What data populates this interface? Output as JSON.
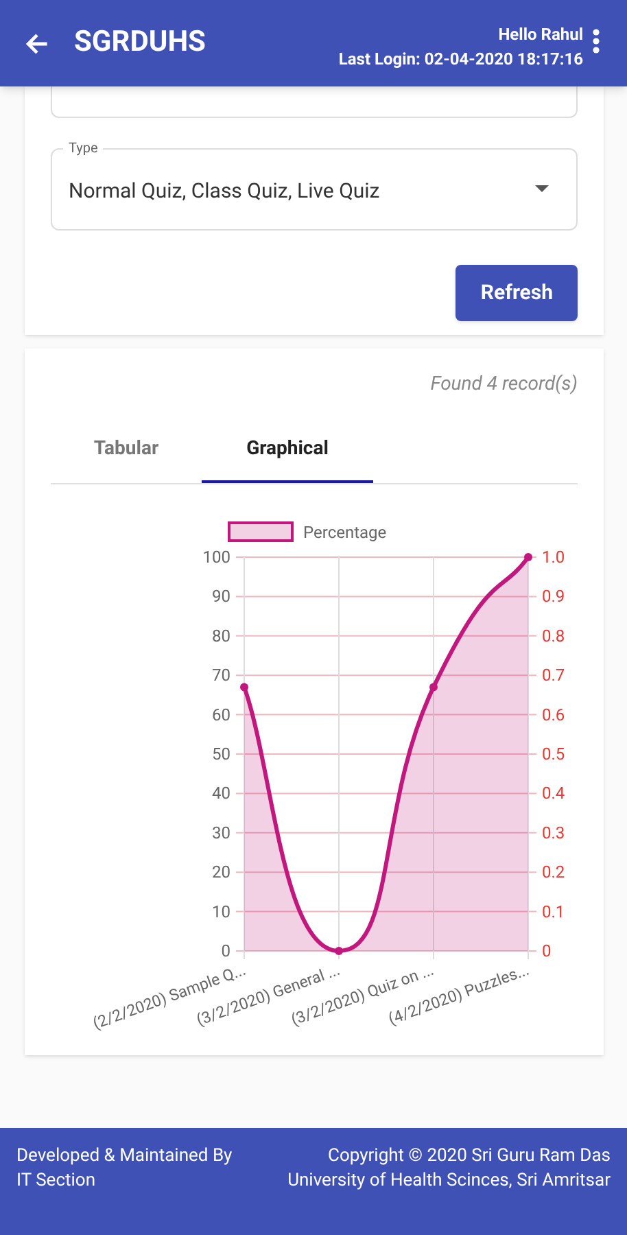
{
  "app_bar": {
    "title": "SGRDUHS",
    "greeting": "Hello Rahul",
    "last_login": "Last Login: 02-04-2020 18:17:16"
  },
  "filters": {
    "type": {
      "label": "Type",
      "value": "Normal Quiz, Class Quiz, Live Quiz"
    },
    "refresh_button": "Refresh"
  },
  "results": {
    "count": "Found 4 record(s)",
    "tabs": [
      {
        "label": "Tabular",
        "selected": false
      },
      {
        "label": "Graphical",
        "selected": true
      }
    ],
    "chart_data": {
      "type": "area",
      "categories": [
        "(2/2/2020) Sample Q...",
        "(3/2/2020) General ...",
        "(3/2/2020) Quiz on ...",
        "(4/2/2020)  Puzzles..."
      ],
      "series": [
        {
          "name": "Percentage",
          "color": "#c2187e",
          "values": [
            67,
            0,
            67,
            100
          ]
        }
      ],
      "grid": true,
      "ylim": [
        0,
        100
      ],
      "yticks": [
        0,
        10,
        20,
        30,
        40,
        50,
        60,
        70,
        80,
        90,
        100
      ],
      "y2ticks": [
        "0",
        "0.1",
        "0.2",
        "0.3",
        "0.4",
        "0.5",
        "0.6",
        "0.7",
        "0.8",
        "0.9",
        "1.0"
      ]
    }
  },
  "footer": {
    "left": "Developed & Maintained By IT Section",
    "right": "Copyright © 2020 Sri Guru Ram Das University of Health Scinces, Sri Amritsar"
  }
}
